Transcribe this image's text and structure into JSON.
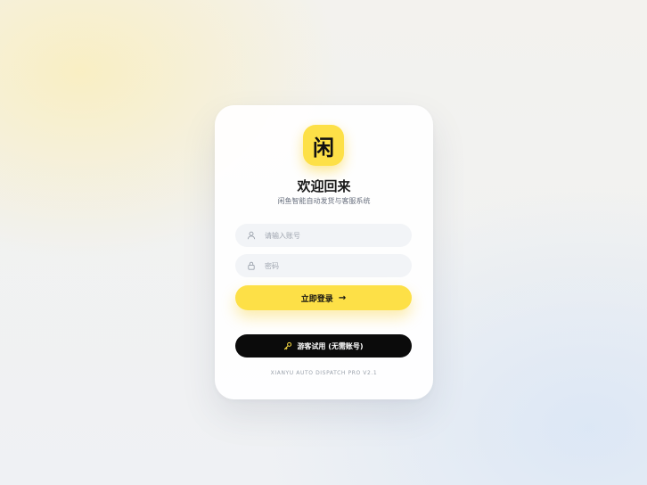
{
  "app": {
    "logo_text": "闲",
    "title": "欢迎回来",
    "subtitle": "闲鱼智能自动发货与客服系统",
    "accent_color": "#fde047"
  },
  "form": {
    "username": {
      "value": "",
      "placeholder": "请输入账号",
      "icon": "user-icon"
    },
    "password": {
      "value": "",
      "placeholder": "密码",
      "icon": "lock-icon"
    },
    "login_button": {
      "label": "立即登录",
      "icon": "arrow-right-icon"
    },
    "guest_button": {
      "label": "游客试用 (无需账号)",
      "icon": "key-icon"
    }
  },
  "footer": {
    "text": "XIANYU AUTO DISPATCH PRO V2.1"
  }
}
